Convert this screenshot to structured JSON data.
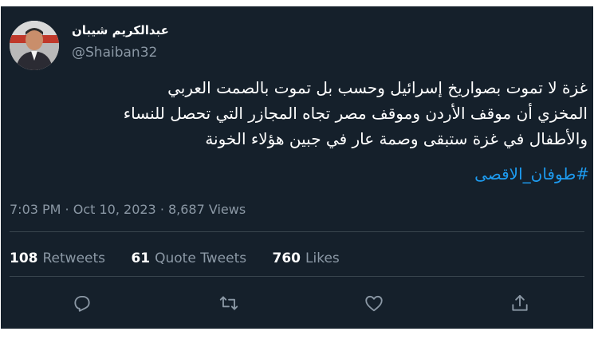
{
  "tweet": {
    "author_name": "عبدالكريم شيبان",
    "handle": "@Shaiban32",
    "text_lines": [
      "غزة لا تموت بصواريخ إسرائيل وحسب بل تموت بالصمت العربي",
      "المخزي أن موقف الأردن وموقف مصر تجاه المجازر التي تحصل للنساء",
      "والأطفال في غزة ستبقى وصمة عار في جبين هؤلاء الخونة"
    ],
    "hashtag": "#طوفان_الاقصى",
    "meta": "7:03 PM · Oct 10, 2023 · 8,687 Views"
  },
  "stats": {
    "retweets_count": "108",
    "retweets_label": "Retweets",
    "quotes_count": "61",
    "quotes_label": "Quote Tweets",
    "likes_count": "760",
    "likes_label": "Likes"
  },
  "actions": {
    "reply_icon": "reply-icon",
    "retweet_icon": "retweet-icon",
    "like_icon": "heart-icon",
    "share_icon": "share-icon"
  },
  "colors": {
    "background": "#15202b",
    "text": "#ffffff",
    "secondary": "#8b98a5",
    "accent": "#1d9bf0",
    "divider": "#38444d"
  }
}
